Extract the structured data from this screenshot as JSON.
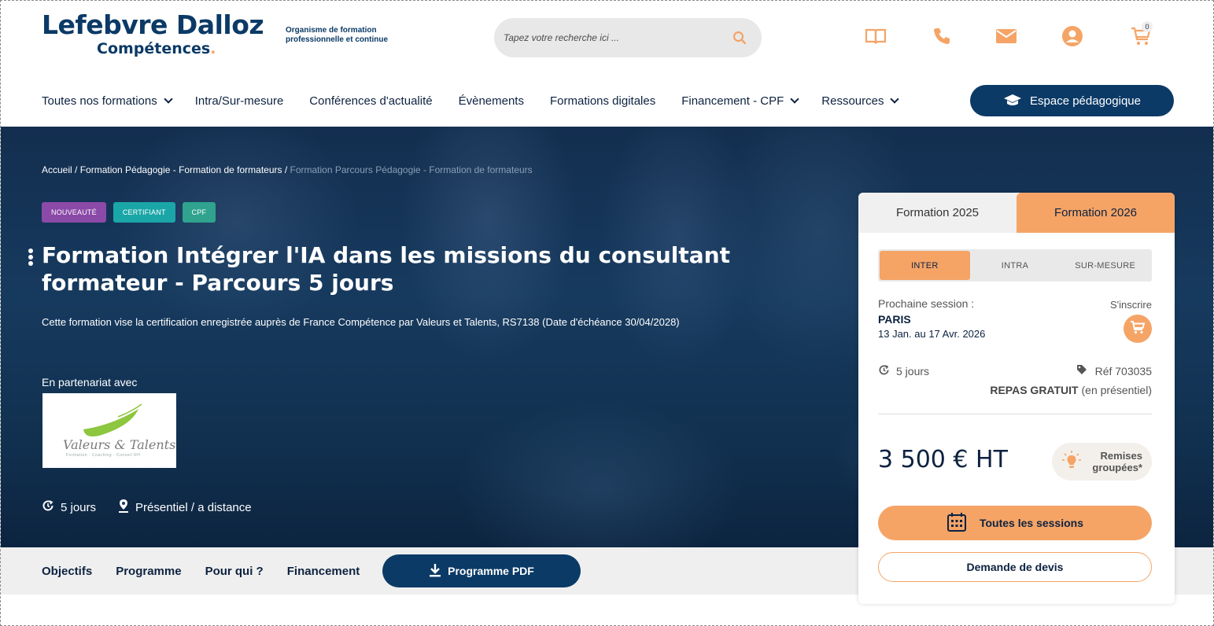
{
  "header": {
    "logo_main": "Lefebvre Dalloz",
    "logo_sub": "Compétences",
    "logo_dot": ".",
    "tagline": "Organisme de formation professionnelle et continue",
    "search": {
      "placeholder": "Tapez votre recherche ici ..."
    },
    "icons": [
      "book-icon",
      "phone-icon",
      "mail-icon",
      "user-icon",
      "cart-icon"
    ],
    "cart_count": "0"
  },
  "nav": {
    "items": [
      {
        "label": "Toutes nos formations",
        "dropdown": true
      },
      {
        "label": "Intra/Sur-mesure",
        "dropdown": false
      },
      {
        "label": "Conférences d'actualité",
        "dropdown": false
      },
      {
        "label": "Évènements",
        "dropdown": false
      },
      {
        "label": "Formations digitales",
        "dropdown": false
      },
      {
        "label": "Financement - CPF",
        "dropdown": true
      },
      {
        "label": "Ressources",
        "dropdown": true
      }
    ],
    "espace_label": "Espace pédagogique"
  },
  "hero": {
    "breadcrumb": {
      "home": "Accueil",
      "sep": " / ",
      "category": "Formation Pédagogie - Formation de formateurs",
      "sep2": " / ",
      "current": "Formation Parcours Pédagogie - Formation de formateurs"
    },
    "badges": [
      {
        "label": "NOUVEAUTÉ",
        "color": "#8b4aa8"
      },
      {
        "label": "CERTIFIANT",
        "color": "#1aa6a6"
      },
      {
        "label": "CPF",
        "color": "#2fa38e"
      }
    ],
    "title": "Formation Intégrer l'IA dans les missions du consultant formateur - Parcours 5 jours",
    "description": "Cette formation vise la certification enregistrée auprès de France Compétence par Valeurs et Talents, RS7138 (Date d'échéance 30/04/2028)",
    "partner_label": "En partenariat avec",
    "partner_name": "Valeurs & Talents",
    "partner_tagline": "Formation · Coaching · Conseil RH",
    "duration": "5 jours",
    "mode": "Présentiel / a distance"
  },
  "subnav": {
    "items": [
      "Objectifs",
      "Programme",
      "Pour qui ?",
      "Financement"
    ],
    "pdf_label": "Programme PDF"
  },
  "card": {
    "tabs": [
      {
        "label": "Formation 2025",
        "active": false
      },
      {
        "label": "Formation 2026",
        "active": true
      }
    ],
    "segments": [
      {
        "label": "INTER",
        "active": true
      },
      {
        "label": "INTRA",
        "active": false
      },
      {
        "label": "SUR-MESURE",
        "active": false
      }
    ],
    "next_session_label": "Prochaine session :",
    "city": "PARIS",
    "dates": "13 Jan. au 17 Avr. 2026",
    "inscrire_label": "S'inscrire",
    "duration": "5 jours",
    "ref": "Réf 703035",
    "repas_bold": "REPAS GRATUIT",
    "repas_rest": " (en présentiel)",
    "price": "3 500 € HT",
    "remises_line1": "Remises",
    "remises_line2": "groupées*",
    "sessions_label": "Toutes les sessions",
    "devis_label": "Demande de devis"
  },
  "colors": {
    "navy": "#0b3a66",
    "accent": "#f5a466"
  }
}
